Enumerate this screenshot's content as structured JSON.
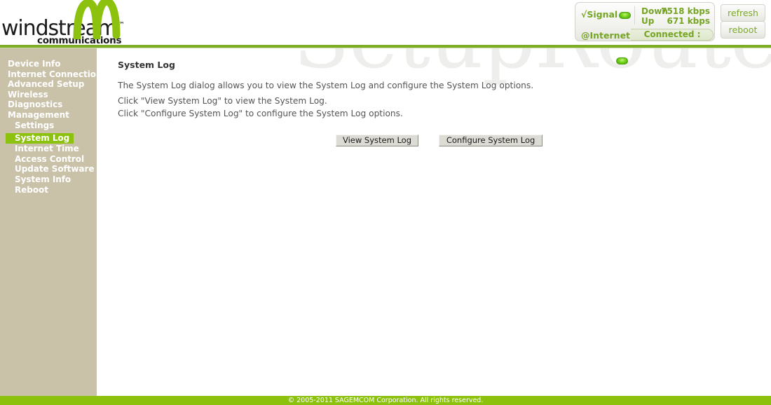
{
  "brand": {
    "wordmark": "windstream",
    "trademark": "™",
    "tagline": "communications",
    "logo_icon": "windstream-wave-logo",
    "logo_color": "#8cc20e"
  },
  "watermark": {
    "text": "SetupRouter.co"
  },
  "status_panel": {
    "signal_label": "√Signal",
    "signal_led": "green-led-on",
    "internet_label": "@Internet",
    "internet_led": "green-led-on",
    "connection_status": "Connected :",
    "rates": [
      {
        "label": "Down",
        "value": "7518 kbps"
      },
      {
        "label": "Up",
        "value": "671 kbps"
      }
    ],
    "refresh_label": "refresh",
    "reboot_label": "reboot",
    "accent_color": "#76a524"
  },
  "sidebar": {
    "active_item": "System Log",
    "active_color": "#8cc20e",
    "background_color": "#c9c1a8",
    "items": [
      {
        "label": "Device Info",
        "level": 0
      },
      {
        "label": "Internet Connection",
        "level": 0
      },
      {
        "label": "Advanced Setup",
        "level": 0
      },
      {
        "label": "Wireless",
        "level": 0
      },
      {
        "label": "Diagnostics",
        "level": 0
      },
      {
        "label": "Management",
        "level": 0
      },
      {
        "label": "Settings",
        "level": 1
      },
      {
        "label": "System Log",
        "level": 1
      },
      {
        "label": "Internet Time",
        "level": 1
      },
      {
        "label": "Access Control",
        "level": 1
      },
      {
        "label": "Update Software",
        "level": 1
      },
      {
        "label": "System Info",
        "level": 1
      },
      {
        "label": "Reboot",
        "level": 1
      }
    ]
  },
  "main": {
    "title": "System Log",
    "paragraphs": [
      "The System Log dialog allows you to view the System Log and configure the System Log options.",
      "Click \"View System Log\" to view the System Log.",
      "Click \"Configure System Log\" to configure the System Log options."
    ],
    "buttons": {
      "view_log": "View System Log",
      "configure_log": "Configure System Log"
    }
  },
  "footer": {
    "copyright": "© 2005-2011 SAGEMCOM Corporation. All rights reserved.",
    "background_color": "#8cc20e"
  }
}
